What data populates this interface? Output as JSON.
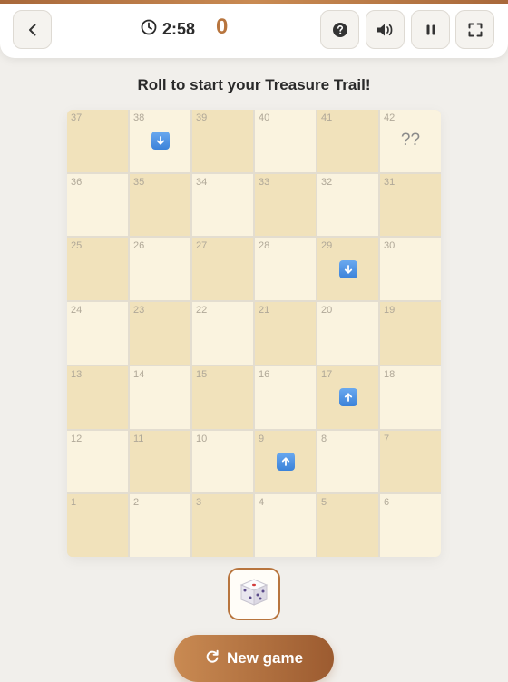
{
  "header": {
    "timer": "2:58",
    "score": "0",
    "icons": {
      "back": "chevron-left-icon",
      "timer": "clock-icon",
      "help": "help-icon",
      "sound": "speaker-icon",
      "pause": "pause-icon",
      "fullscreen": "fullscreen-icon"
    }
  },
  "status_text": "Roll to start your Treasure Trail!",
  "board": {
    "rows": [
      [
        {
          "n": "37",
          "shade": "dark"
        },
        {
          "n": "38",
          "shade": "light",
          "marker": "down"
        },
        {
          "n": "39",
          "shade": "dark"
        },
        {
          "n": "40",
          "shade": "light"
        },
        {
          "n": "41",
          "shade": "dark"
        },
        {
          "n": "42",
          "shade": "light",
          "label": "??"
        }
      ],
      [
        {
          "n": "36",
          "shade": "light"
        },
        {
          "n": "35",
          "shade": "dark"
        },
        {
          "n": "34",
          "shade": "light"
        },
        {
          "n": "33",
          "shade": "dark"
        },
        {
          "n": "32",
          "shade": "light"
        },
        {
          "n": "31",
          "shade": "dark"
        }
      ],
      [
        {
          "n": "25",
          "shade": "dark"
        },
        {
          "n": "26",
          "shade": "light"
        },
        {
          "n": "27",
          "shade": "dark"
        },
        {
          "n": "28",
          "shade": "light"
        },
        {
          "n": "29",
          "shade": "dark",
          "marker": "down"
        },
        {
          "n": "30",
          "shade": "light"
        }
      ],
      [
        {
          "n": "24",
          "shade": "light"
        },
        {
          "n": "23",
          "shade": "dark"
        },
        {
          "n": "22",
          "shade": "light"
        },
        {
          "n": "21",
          "shade": "dark"
        },
        {
          "n": "20",
          "shade": "light"
        },
        {
          "n": "19",
          "shade": "dark"
        }
      ],
      [
        {
          "n": "13",
          "shade": "dark"
        },
        {
          "n": "14",
          "shade": "light"
        },
        {
          "n": "15",
          "shade": "dark"
        },
        {
          "n": "16",
          "shade": "light"
        },
        {
          "n": "17",
          "shade": "dark",
          "marker": "up"
        },
        {
          "n": "18",
          "shade": "light"
        }
      ],
      [
        {
          "n": "12",
          "shade": "light"
        },
        {
          "n": "11",
          "shade": "dark"
        },
        {
          "n": "10",
          "shade": "light"
        },
        {
          "n": "9",
          "shade": "dark",
          "marker": "up"
        },
        {
          "n": "8",
          "shade": "light"
        },
        {
          "n": "7",
          "shade": "dark"
        }
      ],
      [
        {
          "n": "1",
          "shade": "dark"
        },
        {
          "n": "2",
          "shade": "light"
        },
        {
          "n": "3",
          "shade": "dark"
        },
        {
          "n": "4",
          "shade": "light"
        },
        {
          "n": "5",
          "shade": "dark"
        },
        {
          "n": "6",
          "shade": "light"
        }
      ]
    ],
    "colors": {
      "dark": "#f1e2bb",
      "light": "#faf3df",
      "arrow": "#3b82d9"
    }
  },
  "dice": {
    "icon": "dice-icon",
    "face": 3
  },
  "new_game_label": "New game",
  "new_game_icon": "restart-icon",
  "colors": {
    "accent": "#b8753e",
    "background": "#f1efeb"
  }
}
